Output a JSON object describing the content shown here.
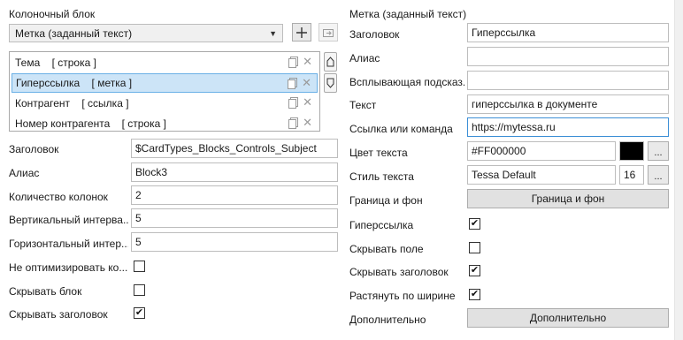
{
  "left": {
    "title": "Колоночный блок",
    "block_combo": {
      "value": "Метка (заданный текст)"
    },
    "list": [
      {
        "label": "Тема    [ строка ]"
      },
      {
        "label": "Гиперссылка    [ метка ]"
      },
      {
        "label": "Контрагент    [ ссылка ]"
      },
      {
        "label": "Номер контрагента    [ строка ]"
      }
    ],
    "fields": {
      "title_label": "Заголовок",
      "title_value": "$CardTypes_Blocks_Controls_Subject",
      "alias_label": "Алиас",
      "alias_value": "Block3",
      "columns_label": "Количество колонок",
      "columns_value": "2",
      "vspacing_label": "Вертикальный интерва...",
      "vspacing_value": "5",
      "hspacing_label": "Горизонтальный интер...",
      "hspacing_value": "5",
      "nooptimize_label": "Не оптимизировать ко...",
      "nooptimize_checked": false,
      "hideblock_label": "Скрывать блок",
      "hideblock_checked": false,
      "hideheader_label": "Скрывать заголовок",
      "hideheader_checked": true
    }
  },
  "right": {
    "title": "Метка (заданный текст)",
    "header_label": "Заголовок",
    "header_value": "Гиперссылка",
    "alias_label": "Алиас",
    "alias_value": "",
    "tooltip_label": "Всплывающая подсказ...",
    "tooltip_value": "",
    "text_label": "Текст",
    "text_value": "гиперссылка в документе",
    "link_label": "Ссылка или команда",
    "link_value": "https://mytessa.ru",
    "color_label": "Цвет текста",
    "color_value": "#FF000000",
    "color_swatch": "#000000",
    "style_label": "Стиль текста",
    "style_value": "Tessa Default",
    "style_size": "16",
    "border_label": "Граница и фон",
    "border_button": "Граница и фон",
    "hyperlink_label": "Гиперссылка",
    "hyperlink_checked": true,
    "hidefield_label": "Скрывать поле",
    "hidefield_checked": false,
    "hideheader_label": "Скрывать заголовок",
    "hideheader_checked": true,
    "stretch_label": "Растянуть по ширине",
    "stretch_checked": true,
    "extra_label": "Дополнительно",
    "extra_button": "Дополнительно"
  },
  "icons": {
    "add": "plus-icon",
    "import": "import-icon",
    "copy": "copy-icon",
    "delete": "close-icon",
    "up": "arrow-up-icon",
    "down": "arrow-down-icon",
    "dropdown": "chevron-down-icon",
    "check": "checkmark-icon"
  },
  "colors": {
    "selection_bg": "#cce4f7",
    "selection_border": "#6ab0e6",
    "focus_border": "#3c8fd6"
  }
}
